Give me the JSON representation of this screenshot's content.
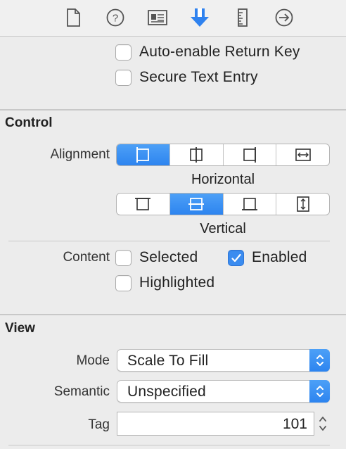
{
  "toolbar": {
    "icons": [
      "file-inspector-icon",
      "quick-help-icon",
      "identity-inspector-icon",
      "attributes-inspector-icon",
      "size-inspector-icon",
      "connections-inspector-icon"
    ],
    "accent": "#2f82ef"
  },
  "text_input_traits": {
    "auto_enable_return_key": {
      "label": "Auto-enable Return Key",
      "checked": false
    },
    "secure_text_entry": {
      "label": "Secure Text Entry",
      "checked": false
    }
  },
  "control": {
    "title": "Control",
    "alignment_label": "Alignment",
    "horizontal_caption": "Horizontal",
    "horizontal_selected_index": 0,
    "vertical_caption": "Vertical",
    "vertical_selected_index": 1,
    "content_label": "Content",
    "selected": {
      "label": "Selected",
      "checked": false
    },
    "enabled": {
      "label": "Enabled",
      "checked": true
    },
    "highlighted": {
      "label": "Highlighted",
      "checked": false
    }
  },
  "view": {
    "title": "View",
    "mode_label": "Mode",
    "mode_value": "Scale To Fill",
    "semantic_label": "Semantic",
    "semantic_value": "Unspecified",
    "tag_label": "Tag",
    "tag_value": "101"
  }
}
